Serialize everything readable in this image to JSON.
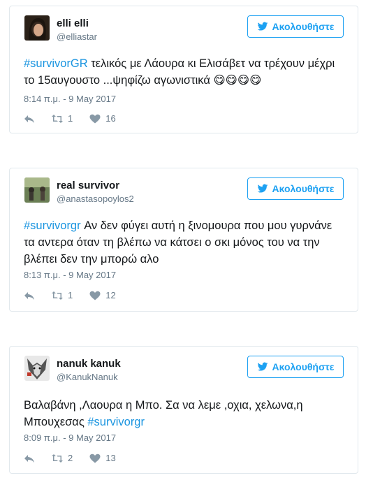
{
  "tweets": [
    {
      "name": "elli elli",
      "handle": "@elliastar",
      "follow_label": "Ακολουθήστε",
      "hashtag": "#survivorGR",
      "text": " τελικός με Λάουρα κι Ελισάβετ να τρέχουν μέχρι το 15αυγουστο ...ψηφίζω αγωνιστικά 😋😋😋😋",
      "time": "8:14 π.μ. - 9 May 2017",
      "retweets": "1",
      "likes": "16"
    },
    {
      "name": "real survivor",
      "handle": "@anastasopoylos2",
      "follow_label": "Ακολουθήστε",
      "hashtag": "#survivorgr",
      "text": " Αν δεν φύγει αυτή η ξινομουρα που μου γυρνάνε τα αντερα όταν τη βλέπω να κάτσει ο σκι μόνος του να την βλέπει δεν την μπορώ αλο",
      "time": "8:13 π.μ. - 9 May 2017",
      "retweets": "1",
      "likes": "12"
    },
    {
      "name": "nanuk kanuk",
      "handle": "@KanukNanuk",
      "follow_label": "Ακολουθήστε",
      "text_before": "Βαλαβάνη ,Λαουρα η Μπο. Σα να λεμε ,οχια, χελωνα,η Μπουχεσας ",
      "hashtag": "#survivorgr",
      "time": "8:09 π.μ. - 9 May 2017",
      "retweets": "2",
      "likes": "13"
    }
  ],
  "colors": {
    "accent": "#1da1f2",
    "hashtag": "#1b95e0",
    "muted": "#657786",
    "border": "#e1e8ed"
  }
}
